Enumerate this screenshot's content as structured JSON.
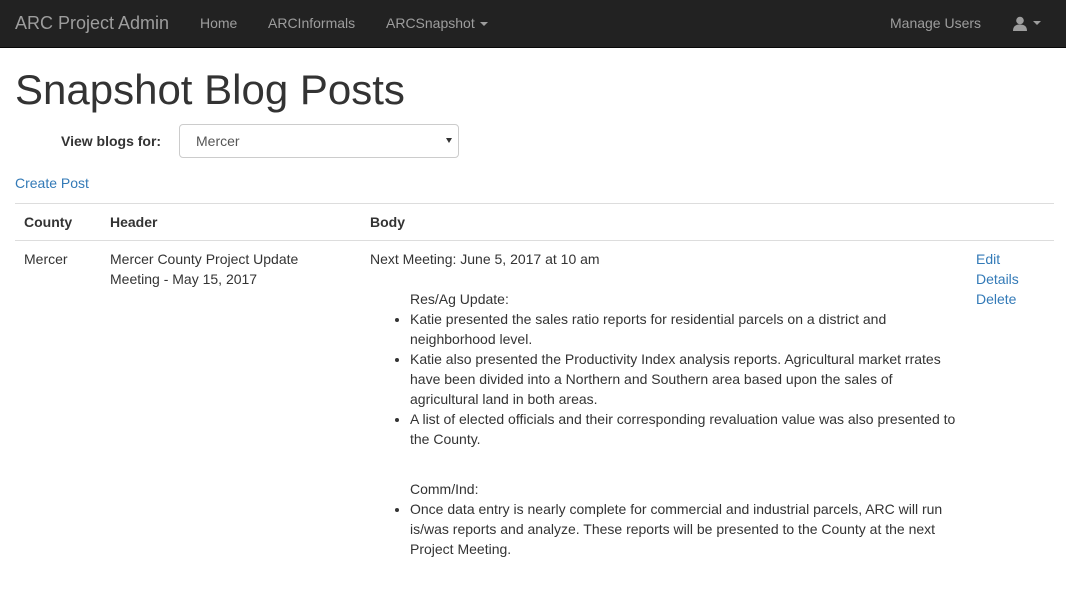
{
  "navbar": {
    "brand": "ARC Project Admin",
    "items": [
      {
        "label": "Home"
      },
      {
        "label": "ARCInformals"
      },
      {
        "label": "ARCSnapshot"
      }
    ],
    "manage_users": "Manage Users",
    "user_icon": "user-icon"
  },
  "page": {
    "title": "Snapshot Blog Posts",
    "filter_label": "View blogs for:",
    "filter_value": "Mercer",
    "create_link": "Create Post"
  },
  "table": {
    "columns": [
      "County",
      "Header",
      "Body"
    ],
    "rows": [
      {
        "county": "Mercer",
        "header": "Mercer County Project Update Meeting - May 15, 2017",
        "body": {
          "intro": "Next Meeting: June 5, 2017 at 10 am",
          "sections": [
            {
              "label": "Res/Ag Update:",
              "bullets": [
                "Katie presented the sales ratio reports for residential parcels on a district and neighborhood level.",
                "Katie also presented the Productivity Index analysis reports. Agricultural market rrates have been divided into a Northern and Southern area based upon the sales of agricultural land in both areas.",
                "A list of elected officials and their corresponding revaluation value was also presented to the County."
              ]
            },
            {
              "label": "Comm/Ind:",
              "bullets": [
                "Once data entry is nearly complete for commercial and industrial parcels, ARC will run is/was reports and analyze. These reports will be presented to the County at the next Project Meeting."
              ]
            }
          ]
        },
        "actions": [
          "Edit",
          "Details",
          "Delete"
        ]
      }
    ]
  },
  "colors": {
    "navbar_bg": "#222222",
    "nav_text": "#9d9d9d",
    "link": "#337ab7"
  }
}
